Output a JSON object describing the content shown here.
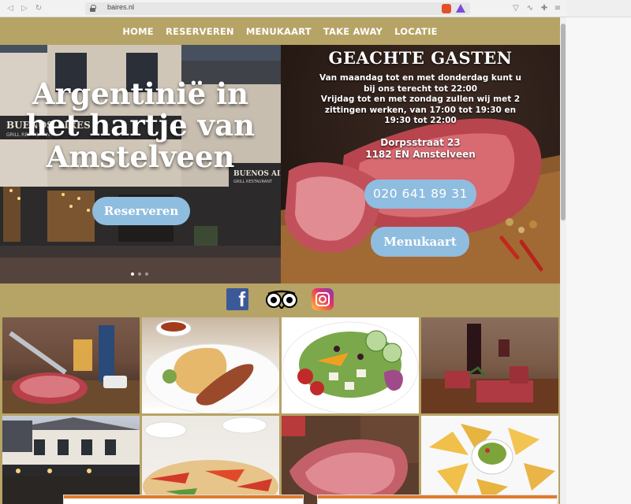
{
  "browser": {
    "url": "baires.nl"
  },
  "nav": {
    "items": [
      "HOME",
      "RESERVEREN",
      "MENUKAART",
      "TAKE AWAY",
      "LOCATIE"
    ]
  },
  "hero": {
    "title_line1": "Argentinië in",
    "title_line2": "het hartje van",
    "title_line3": "Amstelveen",
    "reserve_button": "Reserveren",
    "sign_left": "BUENOS AIRES",
    "sign_left_sub": "GRILL RESTAURANT",
    "sign_right": "BUENOS AIRES",
    "sign_right_sub": "GRILL RESTAURANT",
    "slide_count": 3
  },
  "info": {
    "title": "GEACHTE GASTEN",
    "line1": "Van maandag tot en met donderdag kunt u",
    "line2": "bij ons terecht tot 22:00",
    "line3": "Vrijdag tot en met zondag zullen wij met 2",
    "line4": "zittingen werken, van 17:00 tot 19:30 en",
    "line5": "19:30 tot 22:00",
    "address1": "Dorpsstraat 23",
    "address2": "1182 EN Amstelveen",
    "phone": "020 641 89 31",
    "menu_button": "Menukaart"
  },
  "social": {
    "icons": [
      "facebook-icon",
      "tripadvisor-icon",
      "instagram-icon"
    ],
    "fb_letter": "f"
  },
  "colors": {
    "gold": "#b6a366",
    "pill": "#8fbde0"
  }
}
